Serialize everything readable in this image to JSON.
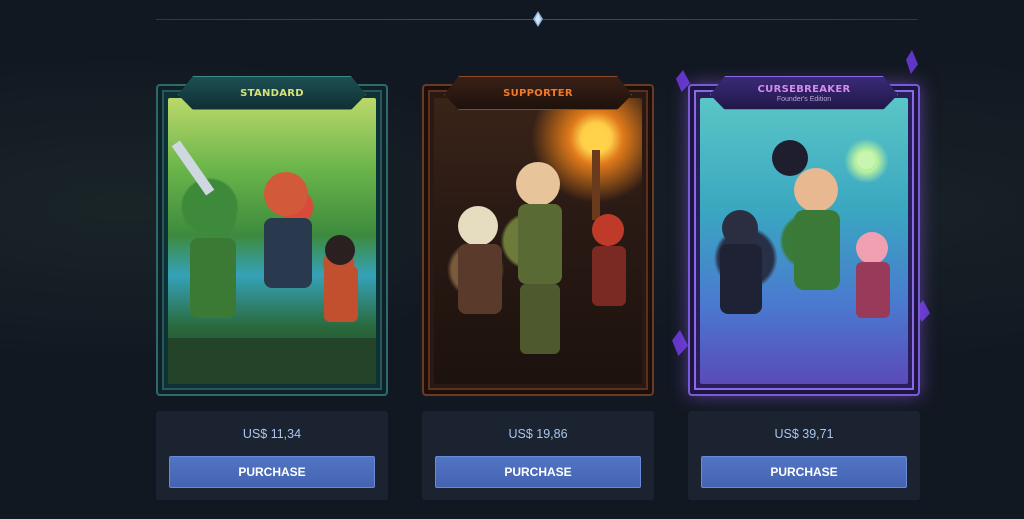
{
  "editions": [
    {
      "name": "STANDARD",
      "subtitle": "",
      "price": "US$ 11,34",
      "button_label": "PURCHASE",
      "accent_color": "#d6e27a"
    },
    {
      "name": "SUPPORTER",
      "subtitle": "",
      "price": "US$ 19,86",
      "button_label": "PURCHASE",
      "accent_color": "#f07a2a"
    },
    {
      "name": "CURSEBREAKER",
      "subtitle": "Founder's Edition",
      "price": "US$ 39,71",
      "button_label": "PURCHASE",
      "accent_color": "#d68af0"
    }
  ],
  "divider": {
    "icon": "diamond-gem-icon"
  },
  "colors": {
    "background": "#121822",
    "button": "#4f70c0",
    "price_text": "#a9c6ec",
    "panel": "#1b2331"
  }
}
